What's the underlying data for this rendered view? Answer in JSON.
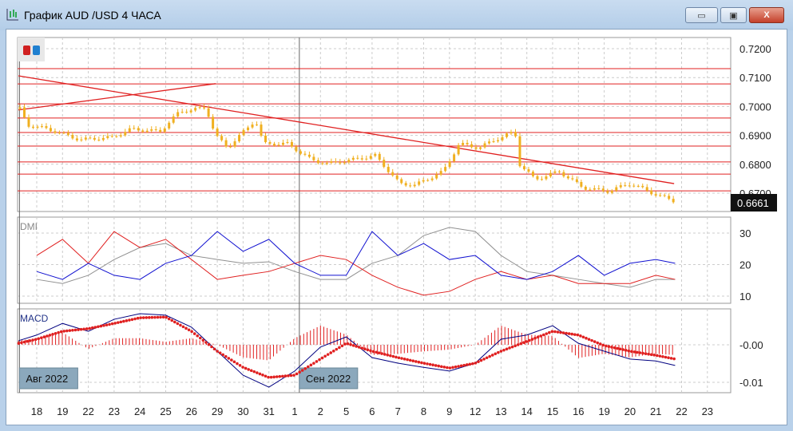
{
  "window": {
    "title": "График AUD /USD  4 ЧАСА",
    "minimize": "▭",
    "maximize": "▣",
    "close": "X"
  },
  "colors": {
    "candle": "#f0b020",
    "level": "#e02020",
    "plus_di": "#1010d0",
    "minus_di": "#e02020",
    "adx": "#909090",
    "macd": "#000080",
    "signal": "#e02020"
  },
  "price_axis": {
    "ticks": [
      "0.7200",
      "0.7100",
      "0.7000",
      "0.6900",
      "0.6800",
      "0.6700"
    ],
    "tick_values": [
      0.72,
      0.71,
      0.7,
      0.69,
      0.68,
      0.67
    ],
    "current": "0.6661"
  },
  "levels": [
    0.7131,
    0.7078,
    0.7009,
    0.696,
    0.691,
    0.6863,
    0.6808,
    0.6766,
    0.6708
  ],
  "trendlines": [
    [
      [
        -0.71,
        0.7106
      ],
      [
        24.71,
        0.6733
      ]
    ],
    [
      [
        -0.71,
        0.6988
      ],
      [
        6.94,
        0.7079
      ]
    ]
  ],
  "price_series": [
    [
      -0.65,
      0.6991
    ],
    [
      -0.34,
      0.6935
    ],
    [
      0.43,
      0.6922
    ],
    [
      1.67,
      0.6885
    ],
    [
      2.91,
      0.6893
    ],
    [
      3.68,
      0.6922
    ],
    [
      4.77,
      0.6913
    ],
    [
      5.54,
      0.6982
    ],
    [
      6.56,
      0.6996
    ],
    [
      6.93,
      0.69
    ],
    [
      7.4,
      0.6857
    ],
    [
      8.48,
      0.6954
    ],
    [
      8.79,
      0.6871
    ],
    [
      9.72,
      0.6871
    ],
    [
      10.65,
      0.6815
    ],
    [
      11.27,
      0.6802
    ],
    [
      12.2,
      0.6815
    ],
    [
      13.13,
      0.683
    ],
    [
      14.06,
      0.6733
    ],
    [
      14.67,
      0.6728
    ],
    [
      15.76,
      0.6775
    ],
    [
      16.38,
      0.6871
    ],
    [
      17.15,
      0.6857
    ],
    [
      17.77,
      0.6885
    ],
    [
      18.54,
      0.6913
    ],
    [
      18.7,
      0.6802
    ],
    [
      19.32,
      0.6747
    ],
    [
      20.25,
      0.6775
    ],
    [
      21.18,
      0.6719
    ],
    [
      22.1,
      0.6706
    ],
    [
      23.03,
      0.6733
    ],
    [
      23.96,
      0.6697
    ],
    [
      24.74,
      0.6672
    ]
  ],
  "dmi": {
    "label": "DMI",
    "ticks": [
      "30",
      "20",
      "10"
    ],
    "tick_values": [
      30,
      20,
      10
    ],
    "x": [
      0,
      1,
      2,
      3,
      4,
      5,
      6,
      7,
      8,
      9,
      10,
      11,
      12,
      13,
      14,
      15,
      16,
      17,
      18,
      19,
      20,
      21,
      22,
      23,
      24,
      24.75
    ],
    "plus_di": [
      17.8,
      15.3,
      20.4,
      16.6,
      15.3,
      20.4,
      22.9,
      30.5,
      24.2,
      28,
      20.4,
      16.6,
      16.6,
      30.5,
      22.9,
      26.7,
      21.6,
      22.9,
      16.6,
      15.3,
      17.8,
      22.9,
      16.6,
      20.4,
      21.6,
      20.4
    ],
    "minus_di": [
      22.9,
      28,
      20.4,
      30.5,
      25.4,
      28,
      21.6,
      15.3,
      16.6,
      17.8,
      20.4,
      22.9,
      21.6,
      16.6,
      12.8,
      10.3,
      11.5,
      15.3,
      17.8,
      15.3,
      16.6,
      14,
      14,
      14,
      16.6,
      15.3
    ],
    "adx": [
      15.3,
      14,
      16.6,
      21.6,
      25.4,
      26.7,
      22.9,
      21.6,
      20.4,
      20.9,
      17.8,
      15.3,
      15.3,
      20.4,
      22.9,
      29.2,
      31.8,
      30.5,
      22.9,
      17.8,
      16.6,
      15.3,
      14,
      12.8,
      15.3,
      15.3
    ]
  },
  "macd": {
    "label": "MACD",
    "ticks": [
      "-0.00",
      "-0.01"
    ],
    "tick_values": [
      0,
      -0.01
    ],
    "x": [
      -0.7,
      0,
      1,
      2,
      3,
      4,
      5,
      6,
      7,
      8,
      9,
      10,
      11,
      12,
      13,
      14,
      15,
      16,
      17,
      18,
      19,
      20,
      21,
      22,
      23,
      24,
      24.75
    ],
    "macd": [
      1.1,
      2.6,
      5.7,
      3.6,
      6.8,
      8.3,
      7.9,
      4.7,
      -1.7,
      -8.1,
      -11.3,
      -7,
      -0.6,
      2.1,
      -3.4,
      -4.9,
      -6,
      -7,
      -4.9,
      1.5,
      2.6,
      5.1,
      0.4,
      -1.7,
      -3.8,
      -4.3,
      -5.5
    ],
    "signal": [
      0.4,
      1.5,
      3.6,
      4.3,
      5.7,
      7.2,
      7.4,
      3.6,
      -1.7,
      -6,
      -8.7,
      -8.1,
      -3.8,
      0.4,
      -1.7,
      -3.4,
      -4.9,
      -6.2,
      -4.9,
      -1.7,
      0.9,
      3.6,
      2.6,
      -0.2,
      -1.7,
      -2.8,
      -3.8
    ]
  },
  "month_labels": [
    {
      "text": "Авг 2022",
      "day_index": -0.7
    },
    {
      "text": "Сен 2022",
      "day_index": 10.15
    }
  ],
  "x_axis": [
    "18",
    "19",
    "22",
    "23",
    "24",
    "25",
    "26",
    "29",
    "30",
    "31",
    "1",
    "2",
    "5",
    "6",
    "7",
    "8",
    "9",
    "12",
    "13",
    "14",
    "15",
    "16",
    "19",
    "20",
    "21",
    "22",
    "23"
  ]
}
